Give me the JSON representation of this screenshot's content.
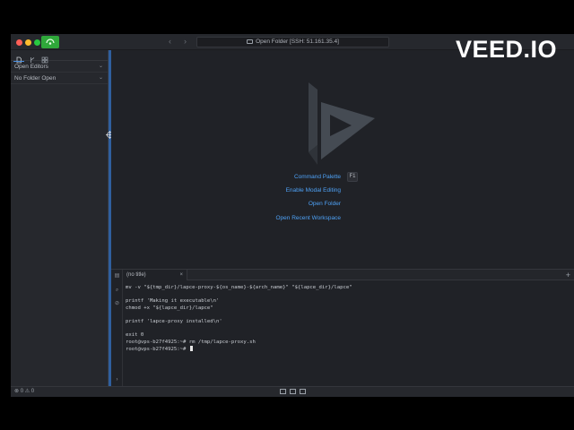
{
  "titlebar": {
    "palette_text": "Open Folder [SSH: 51.161.35.4]",
    "nav_back": "‹",
    "nav_forward": "›"
  },
  "watermark": "VEED.IO",
  "sidebar": {
    "panels": [
      {
        "label": "Open Editors",
        "chevron": "⌄"
      },
      {
        "label": "No Folder Open",
        "chevron": "⌄"
      }
    ]
  },
  "editor": {
    "actions": [
      {
        "label": "Command Palette",
        "shortcut": "F1"
      },
      {
        "label": "Enable Modal Editing"
      },
      {
        "label": "Open Folder"
      },
      {
        "label": "Open Recent Workspace"
      }
    ]
  },
  "terminal": {
    "tab_title": "(no title)",
    "close": "×",
    "new_tab": "+",
    "lines": [
      "mv -v \"${tmp_dir}/lapce-proxy-${os_name}-${arch_name}\" \"${lapce_dir}/lapce\"",
      "",
      "printf 'Making it executable\\n'",
      "chmod +x \"${lapce_dir}/lapce\"",
      "",
      "printf 'lapce-proxy installed\\n'",
      "",
      "exit 0",
      "root@vps-b27f4925:~# rm /tmp/lapce-proxy.sh",
      "root@vps-b27f4925:~# "
    ]
  },
  "statusbar": {
    "errors": "0",
    "warnings": "0"
  },
  "colors": {
    "accent": "#4ea1f5",
    "remote_green": "#2fa83a",
    "bg": "#202227"
  }
}
